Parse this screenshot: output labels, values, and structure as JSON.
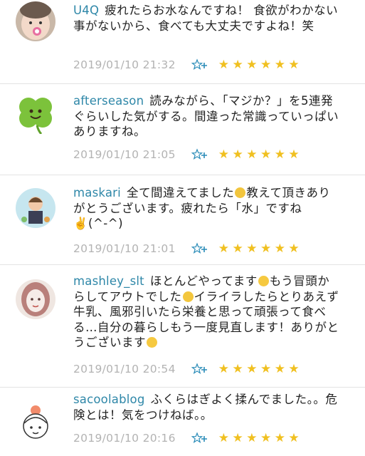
{
  "comments": [
    {
      "user": "U4Q",
      "text": "疲れたらお水なんですね！ 食欲がわかない事がないから、食べても大丈夫ですよね！笑",
      "time": "2019/01/10 21:32",
      "stars": "★★★★★★",
      "avatar": "baby-photo-avatar"
    },
    {
      "user": "afterseason",
      "text": "読みながら、「マジか？」を5連発ぐらいした気がする。間違った常識っていっぱいありますね。",
      "time": "2019/01/10 21:05",
      "stars": "★★★★★★",
      "avatar": "clover-face-avatar"
    },
    {
      "user": "maskari",
      "text_before": "全て間違えてました",
      "emoji1": "crying-face-emoji",
      "text_after": "教えて頂きありがとうございます。疲れたら「水」ですね",
      "text_tail": "✌️(^-^)",
      "time": "2019/01/10 21:01",
      "stars": "★★★★★★",
      "avatar": "character-avatar"
    },
    {
      "user": "mashley_slt",
      "text_a": "ほとんどやってます",
      "emoji_a": "grinning-face-emoji",
      "text_b": "もう冒頭からしてアウトでした",
      "emoji_b": "screaming-face-emoji",
      "text_c": "イライラしたらとりあえず牛乳、風邪引いたら栄養と思って頑張って食べる…自分の暮らしもう一度見直します！ありがとうございます",
      "emoji_c": "smiling-face-emoji",
      "time": "2019/01/10 20:54",
      "stars": "★★★★★★",
      "avatar": "illustrated-woman-avatar"
    },
    {
      "user": "sacoolablog",
      "text": "ふくらはぎよく揉んでました。。危険とは！気をつけねば。。",
      "time": "2019/01/10 20:16",
      "stars": "★★★★★★",
      "avatar": "cartoon-girl-avatar"
    }
  ],
  "colors": {
    "username": "#2e87a8",
    "timestamp": "#b3b3b3",
    "star": "#f0c020",
    "add_star": "#2a8cb8"
  },
  "icons": {
    "add_star": "add-star-icon",
    "star": "star-icon"
  }
}
